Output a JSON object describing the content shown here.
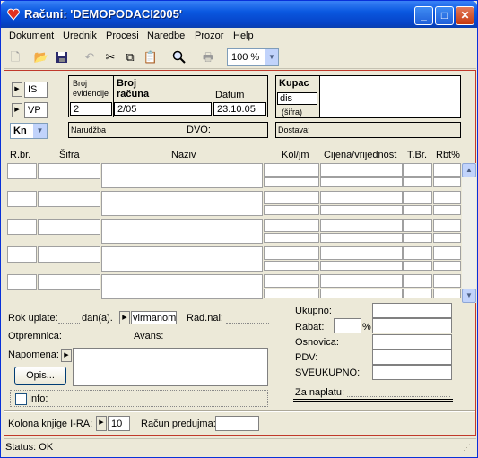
{
  "window": {
    "title": "Računi: 'DEMOPODACI2005'"
  },
  "menu": [
    "Dokument",
    "Urednik",
    "Procesi",
    "Naredbe",
    "Prozor",
    "Help"
  ],
  "toolbar": {
    "zoom": "100 %"
  },
  "header": {
    "type1": "IS",
    "type2": "VP",
    "currency": "Kn",
    "broj_evidencije_label1": "Broj",
    "broj_evidencije_label2": "evidencije",
    "broj_evidencije": "2",
    "broj_racuna_label1": "Broj",
    "broj_racuna_label2": "računa",
    "broj_racuna": "2/05",
    "datum_label": "Datum",
    "datum": "23.10.05",
    "kupac_label": "Kupac",
    "kupac_sifra": "dis",
    "sifra_label": "(šifra)",
    "narudzba_label": "Narudžba",
    "dvo_label": "DVO:",
    "dostava_label": "Dostava:"
  },
  "grid": {
    "columns": [
      "R.br.",
      "Šifra",
      "Naziv",
      "Kol/jm",
      "Cijena/vrijednost",
      "T.Br.",
      "Rbt%"
    ]
  },
  "footer": {
    "rok_uplate_label": "Rok uplate:",
    "dan_label": "dan(a).",
    "nacin_placanja": "virmanom",
    "rad_nal_label": "Rad.nal:",
    "otpremnica_label": "Otpremnica:",
    "avans_label": "Avans:",
    "napomena_label": "Napomena:",
    "opis_button": "Opis...",
    "info_label": "Info:",
    "ukupno_label": "Ukupno:",
    "rabat_label": "Rabat:",
    "percent": "%",
    "osnovica_label": "Osnovica:",
    "pdv_label": "PDV:",
    "sveukupno_label": "SVEUKUPNO:",
    "za_naplatu_label": "Za naplatu:",
    "kolona_label": "Kolona knjige I-RA:",
    "kolona_value": "10",
    "racun_predujma_label": "Račun predujma:"
  },
  "status": {
    "text": "Status: OK"
  },
  "icons": [
    "app-icon",
    "new-doc-icon",
    "open-folder-icon",
    "save-icon",
    "undo-icon",
    "cut-icon",
    "copy-icon",
    "paste-icon",
    "find-icon",
    "print-icon"
  ]
}
